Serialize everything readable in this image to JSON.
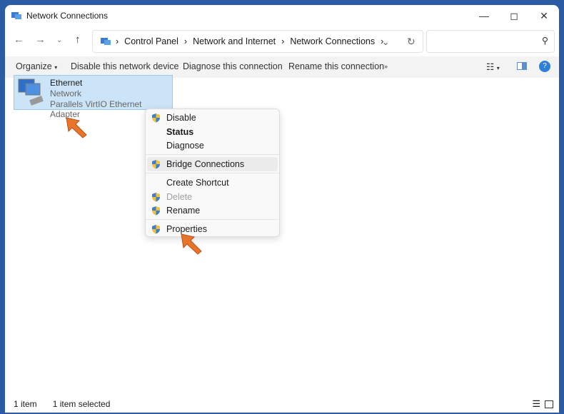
{
  "window": {
    "title": "Network Connections"
  },
  "breadcrumb": [
    "Control Panel",
    "Network and Internet",
    "Network Connections"
  ],
  "search": {
    "placeholder": ""
  },
  "toolbar": {
    "organize": "Organize",
    "disable": "Disable this network device",
    "diagnose": "Diagnose this connection",
    "rename": "Rename this connection",
    "more": "»"
  },
  "item": {
    "name": "Ethernet",
    "status": "Network",
    "adapter": "Parallels VirtIO Ethernet Adapter"
  },
  "menu": [
    {
      "label": "Disable",
      "shield": true
    },
    {
      "label": "Status",
      "bold": true
    },
    {
      "label": "Diagnose"
    },
    {
      "label": "Bridge Connections",
      "shield": true
    },
    {
      "label": "Create Shortcut"
    },
    {
      "label": "Delete",
      "shield": true,
      "disabled": true
    },
    {
      "label": "Rename",
      "shield": true
    },
    {
      "label": "Properties",
      "shield": true
    }
  ],
  "statusbar": {
    "count": "1 item",
    "selected": "1 item selected"
  },
  "colors": {
    "accent": "#0067c0",
    "selection": "#cce4f7",
    "arrow": "#e8752a"
  }
}
